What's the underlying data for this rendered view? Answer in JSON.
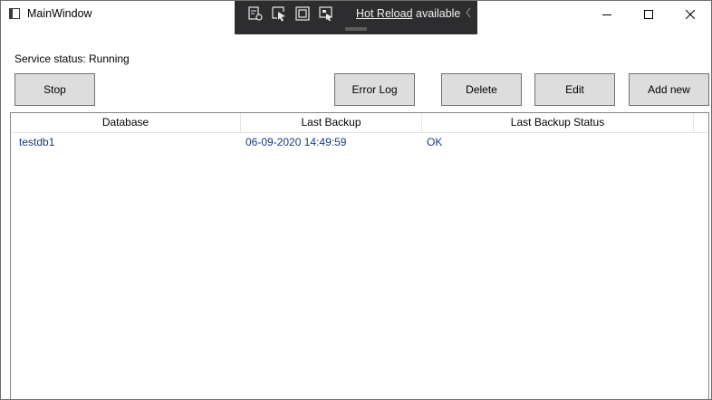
{
  "window": {
    "title": "MainWindow",
    "minimize_icon": "minimize-icon",
    "maximize_icon": "maximize-icon",
    "close_icon": "close-icon"
  },
  "hot_reload": {
    "link": "Hot Reload",
    "suffix": "available",
    "tools": [
      "live-visual-tree-icon",
      "select-element-icon",
      "display-layout-adorners-icon",
      "track-focus-icon"
    ]
  },
  "service": {
    "label": "Service status:",
    "value": "Running"
  },
  "buttons": {
    "stop": "Stop",
    "error_log": "Error Log",
    "delete": "Delete",
    "edit": "Edit",
    "add_new": "Add new"
  },
  "table": {
    "columns": [
      "Database",
      "Last Backup",
      "Last Backup Status"
    ],
    "rows": [
      [
        "testdb1",
        "06-09-2020 14:49:59",
        "OK"
      ]
    ]
  },
  "colors": {
    "button_bg": "#dddddd",
    "toolbar_bg": "#2d2d30",
    "cell_text": "#1a3a7a"
  }
}
